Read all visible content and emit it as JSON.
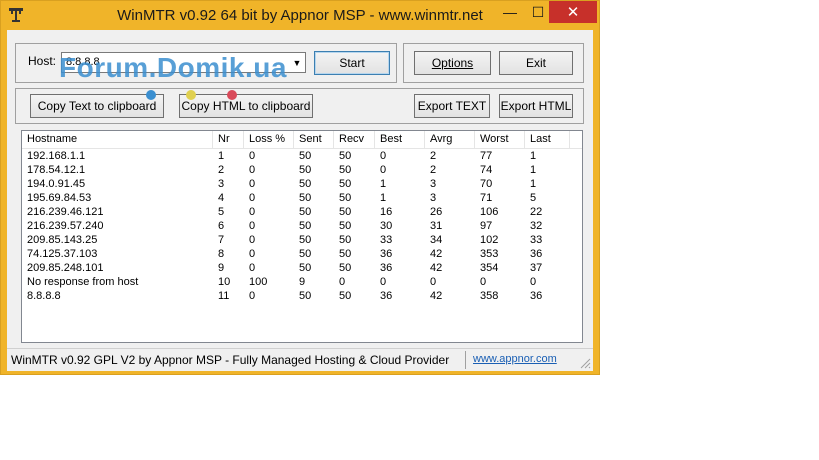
{
  "window": {
    "title": "WinMTR v0.92 64 bit by Appnor MSP - www.winmtr.net",
    "minimize_glyph": "—",
    "maximize_glyph": "☐",
    "close_glyph": "✕"
  },
  "host": {
    "label": "Host:",
    "value": "8.8.8.8",
    "start_label": "Start"
  },
  "options_label": "Options",
  "exit_label": "Exit",
  "copy_text_label": "Copy Text to clipboard",
  "copy_html_label": "Copy HTML to clipboard",
  "export_text_label": "Export TEXT",
  "export_html_label": "Export HTML",
  "watermark": "Forum.Domik.ua",
  "table": {
    "columns": [
      "Hostname",
      "Nr",
      "Loss %",
      "Sent",
      "Recv",
      "Best",
      "Avrg",
      "Worst",
      "Last"
    ],
    "rows": [
      [
        "192.168.1.1",
        "1",
        "0",
        "50",
        "50",
        "0",
        "2",
        "77",
        "1"
      ],
      [
        "178.54.12.1",
        "2",
        "0",
        "50",
        "50",
        "0",
        "2",
        "74",
        "1"
      ],
      [
        "194.0.91.45",
        "3",
        "0",
        "50",
        "50",
        "1",
        "3",
        "70",
        "1"
      ],
      [
        "195.69.84.53",
        "4",
        "0",
        "50",
        "50",
        "1",
        "3",
        "71",
        "5"
      ],
      [
        "216.239.46.121",
        "5",
        "0",
        "50",
        "50",
        "16",
        "26",
        "106",
        "22"
      ],
      [
        "216.239.57.240",
        "6",
        "0",
        "50",
        "50",
        "30",
        "31",
        "97",
        "32"
      ],
      [
        "209.85.143.25",
        "7",
        "0",
        "50",
        "50",
        "33",
        "34",
        "102",
        "33"
      ],
      [
        "74.125.37.103",
        "8",
        "0",
        "50",
        "50",
        "36",
        "42",
        "353",
        "36"
      ],
      [
        "209.85.248.101",
        "9",
        "0",
        "50",
        "50",
        "36",
        "42",
        "354",
        "37"
      ],
      [
        "No response from host",
        "10",
        "100",
        "9",
        "0",
        "0",
        "0",
        "0",
        "0"
      ],
      [
        "8.8.8.8",
        "11",
        "0",
        "50",
        "50",
        "36",
        "42",
        "358",
        "36"
      ]
    ]
  },
  "status": {
    "text": "WinMTR v0.92 GPL V2 by Appnor MSP - Fully Managed Hosting & Cloud Provider",
    "link": "www.appnor.com"
  },
  "colors": {
    "frame": "#f0b429",
    "close": "#c7302a",
    "watermark": "#3b8fd0",
    "dot_blue": "#3b8fd0",
    "dot_yellow": "#e0d050",
    "dot_red": "#d94a5a"
  }
}
